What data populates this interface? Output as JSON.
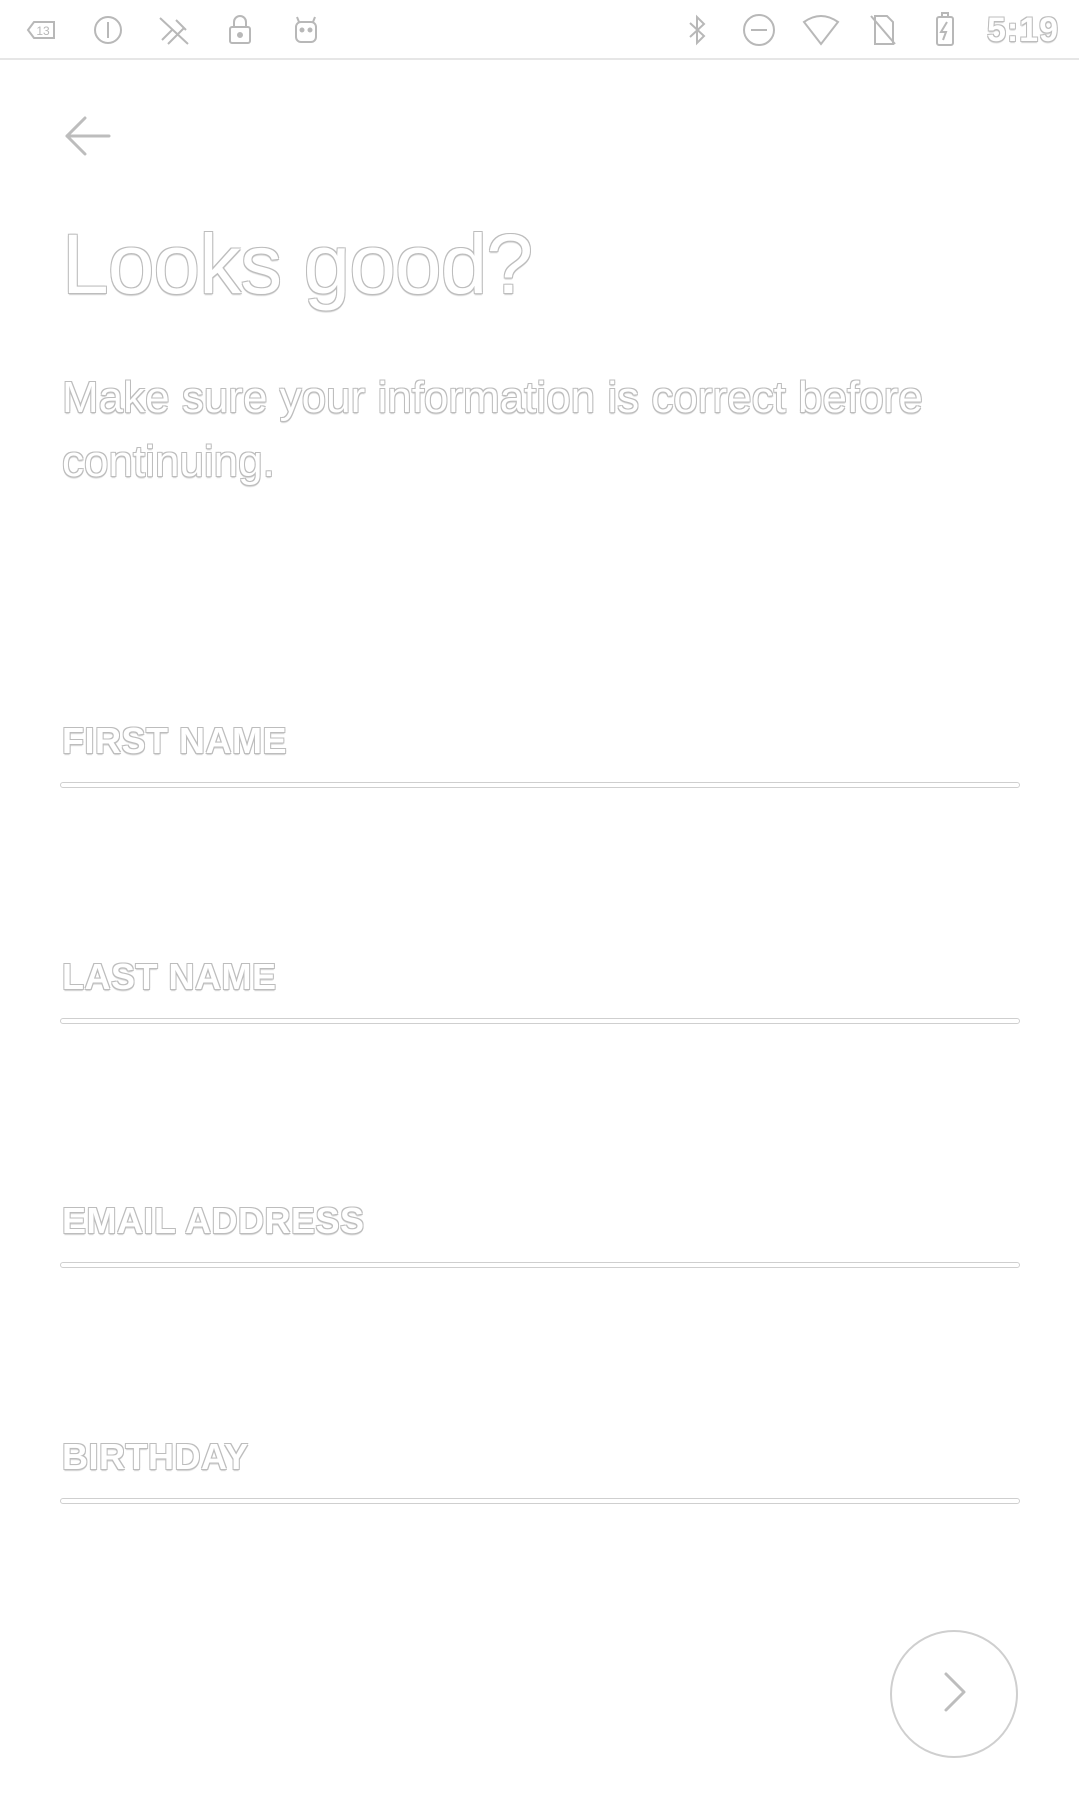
{
  "status_bar": {
    "left_icons": [
      "notification-count-icon",
      "data-saver-icon",
      "no-sim-call-icon",
      "lock-icon",
      "android-icon"
    ],
    "notification_count": "13",
    "right_icons": [
      "bluetooth-icon",
      "do-not-disturb-icon",
      "wifi-icon",
      "no-sim-icon",
      "battery-charging-icon"
    ],
    "time": "5:19"
  },
  "header": {
    "back_icon": "arrow-left-icon",
    "title": "Looks good?",
    "subtitle": "Make sure your information is correct before continuing."
  },
  "form": {
    "fields": [
      {
        "label": "FIRST NAME",
        "value": ""
      },
      {
        "label": "LAST NAME",
        "value": ""
      },
      {
        "label": "EMAIL ADDRESS",
        "value": ""
      },
      {
        "label": "BIRTHDAY",
        "value": ""
      }
    ]
  },
  "footer": {
    "next_icon": "chevron-right-icon"
  },
  "colors": {
    "background": "#ffffff",
    "outline": "#bdbdbd",
    "underline": "#cfcfcf"
  }
}
